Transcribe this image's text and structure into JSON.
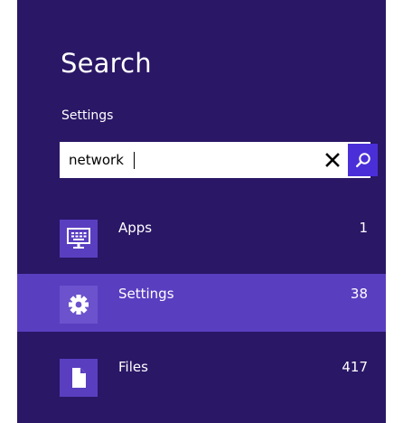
{
  "pane": {
    "title": "Search",
    "scope_label": "Settings",
    "background_color": "#2a1766",
    "selected_color": "#5a3ec0",
    "accent_color": "#4a2fd8"
  },
  "search": {
    "value": "network",
    "placeholder": "",
    "clear_icon": "close-icon",
    "submit_icon": "search-icon"
  },
  "results": [
    {
      "label": "Apps",
      "count": "1",
      "icon": "keyboard-monitor-icon",
      "selected": false
    },
    {
      "label": "Settings",
      "count": "38",
      "icon": "gear-icon",
      "selected": true
    },
    {
      "label": "Files",
      "count": "417",
      "icon": "file-icon",
      "selected": false
    }
  ]
}
